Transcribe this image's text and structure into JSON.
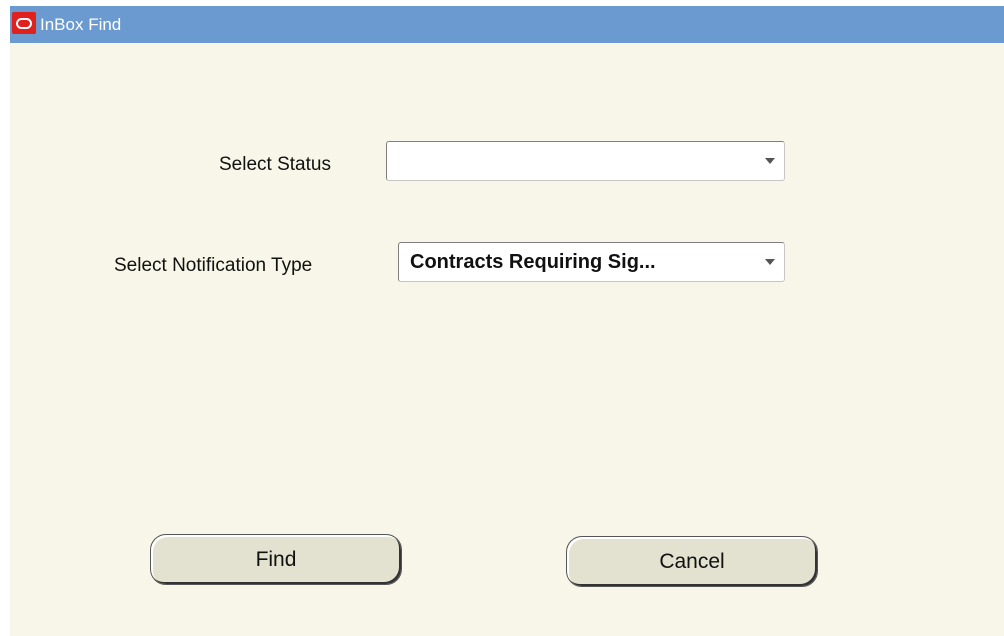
{
  "window": {
    "title": "InBox Find"
  },
  "form": {
    "status_label": "Select Status",
    "status_value": "",
    "notification_type_label": "Select Notification Type",
    "notification_type_value": "Contracts Requiring Sig..."
  },
  "buttons": {
    "find_label": "Find",
    "cancel_label": "Cancel"
  },
  "icons": {
    "app_logo": "oracle-logo-icon",
    "dropdown": "chevron-down-icon"
  },
  "colors": {
    "titlebar": "#6b9ad0",
    "background": "#f7f6e8",
    "logo": "#e0211d",
    "button": "#e3e1cf"
  }
}
